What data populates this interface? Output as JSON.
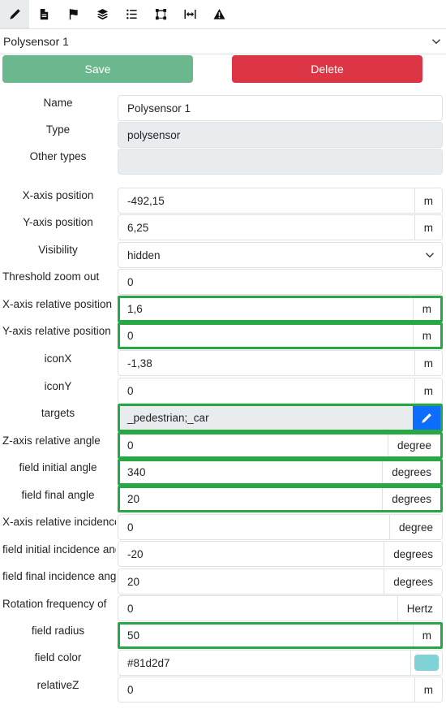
{
  "toolbar": {
    "tools": [
      {
        "name": "edit",
        "active": true
      },
      {
        "name": "document"
      },
      {
        "name": "flag"
      },
      {
        "name": "layers"
      },
      {
        "name": "list"
      },
      {
        "name": "shape"
      },
      {
        "name": "measure"
      },
      {
        "name": "warning"
      }
    ]
  },
  "selector": {
    "value": "Polysensor 1"
  },
  "actions": {
    "save_label": "Save",
    "delete_label": "Delete"
  },
  "colors": {
    "save": "#6cb88e",
    "delete": "#dc3545",
    "highlight": "#28a745",
    "edit_button": "#0d6efd",
    "field_color": "#81d2d7"
  },
  "form": {
    "name": {
      "label": "Name",
      "value": "Polysensor 1"
    },
    "type": {
      "label": "Type",
      "value": "polysensor"
    },
    "other_types": {
      "label": "Other types",
      "value": ""
    },
    "x_position": {
      "label": "X-axis position",
      "value": "-492,15",
      "unit": "m"
    },
    "y_position": {
      "label": "Y-axis position",
      "value": "6,25",
      "unit": "m"
    },
    "visibility": {
      "label": "Visibility",
      "value": "hidden"
    },
    "threshold_zoom_out": {
      "label": "Threshold zoom out",
      "value": "0"
    },
    "x_relative": {
      "label": "X-axis relative position",
      "value": "1,6",
      "unit": "m"
    },
    "y_relative": {
      "label": "Y-axis relative position",
      "value": "0",
      "unit": "m"
    },
    "icon_x": {
      "label": "iconX",
      "value": "-1,38",
      "unit": "m"
    },
    "icon_y": {
      "label": "iconY",
      "value": "0",
      "unit": "m"
    },
    "targets": {
      "label": "targets",
      "value": "_pedestrian;_car"
    },
    "z_relative_angle": {
      "label": "Z-axis relative angle",
      "value": "0",
      "unit": "degree"
    },
    "field_initial_angle": {
      "label": "field initial angle",
      "value": "340",
      "unit": "degrees"
    },
    "field_final_angle": {
      "label": "field final angle",
      "value": "20",
      "unit": "degrees"
    },
    "x_relative_incidence": {
      "label": "X-axis relative incidence",
      "value": "0",
      "unit": "degree"
    },
    "field_initial_incidence": {
      "label": "field initial incidence angle",
      "value": "-20",
      "unit": "degrees"
    },
    "field_final_incidence": {
      "label": "field final incidence angle",
      "value": "20",
      "unit": "degrees"
    },
    "rotation_frequency": {
      "label": "Rotation frequency of",
      "value": "0",
      "unit": "Hertz"
    },
    "field_radius": {
      "label": "field radius",
      "value": "50",
      "unit": "m"
    },
    "field_color": {
      "label": "field color",
      "value": "#81d2d7"
    },
    "relative_z": {
      "label": "relativeZ",
      "value": "0",
      "unit": "m"
    }
  }
}
